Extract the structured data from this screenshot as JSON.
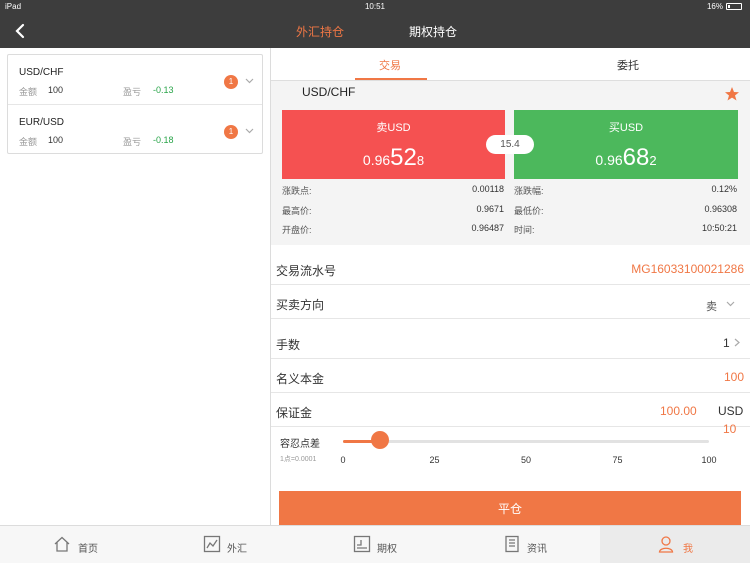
{
  "status_bar": {
    "device": "iPad",
    "time": "10:51",
    "battery": "16%"
  },
  "nav": {
    "tabs": [
      {
        "label": "外汇持仓",
        "active": true
      },
      {
        "label": "期权持仓",
        "active": false
      }
    ]
  },
  "positions": [
    {
      "symbol": "USD/CHF",
      "amount_label": "金额",
      "amount": "100",
      "pl_label": "盈亏",
      "pl": "-0.13",
      "badge": "1"
    },
    {
      "symbol": "EUR/USD",
      "amount_label": "金额",
      "amount": "100",
      "pl_label": "盈亏",
      "pl": "-0.18",
      "badge": "1"
    }
  ],
  "segment": {
    "tabs": [
      {
        "label": "交易",
        "active": true
      },
      {
        "label": "委托",
        "active": false
      }
    ]
  },
  "quote": {
    "symbol": "USD/CHF",
    "sell": {
      "label": "卖USD",
      "price_prefix": "0.96",
      "price_big": "52",
      "price_suffix": "8"
    },
    "buy": {
      "label": "买USD",
      "price_prefix": "0.96",
      "price_big": "68",
      "price_suffix": "2"
    },
    "spread": "15.4",
    "stats_left": [
      {
        "label": "涨跌点:",
        "value": "0.00118"
      },
      {
        "label": "最高价:",
        "value": "0.9671"
      },
      {
        "label": "开盘价:",
        "value": "0.96487"
      }
    ],
    "stats_right": [
      {
        "label": "涨跌幅:",
        "value": "0.12%"
      },
      {
        "label": "最低价:",
        "value": "0.96308"
      },
      {
        "label": "时间:",
        "value": "10:50:21"
      }
    ]
  },
  "form": {
    "serial": {
      "label": "交易流水号",
      "value": "MG16033100021286"
    },
    "direction": {
      "label": "买卖方向",
      "value": "卖"
    },
    "lots": {
      "label": "手数",
      "value": "1"
    },
    "notional": {
      "label": "名义本金",
      "value": "100"
    },
    "margin": {
      "label": "保证金",
      "value": "100.00",
      "currency": "USD"
    }
  },
  "slippage": {
    "label": "容忍点差",
    "sub": "1点=0.0001",
    "value": "10",
    "min": 0,
    "max": 100,
    "current": 10,
    "ticks": [
      "0",
      "25",
      "50",
      "75",
      "100"
    ]
  },
  "close_button": "平仓",
  "tabbar": [
    {
      "label": "首页",
      "icon": "home-icon",
      "active": false
    },
    {
      "label": "外汇",
      "icon": "forex-chart-icon",
      "active": false
    },
    {
      "label": "期权",
      "icon": "options-chart-icon",
      "active": false
    },
    {
      "label": "资讯",
      "icon": "news-icon",
      "active": false
    },
    {
      "label": "我",
      "icon": "user-icon",
      "active": true
    }
  ],
  "colors": {
    "accent": "#f07745",
    "sell": "#f55151",
    "buy": "#4cb85c",
    "bar": "#3d3d3d",
    "profit_text": "#2aa54a"
  }
}
